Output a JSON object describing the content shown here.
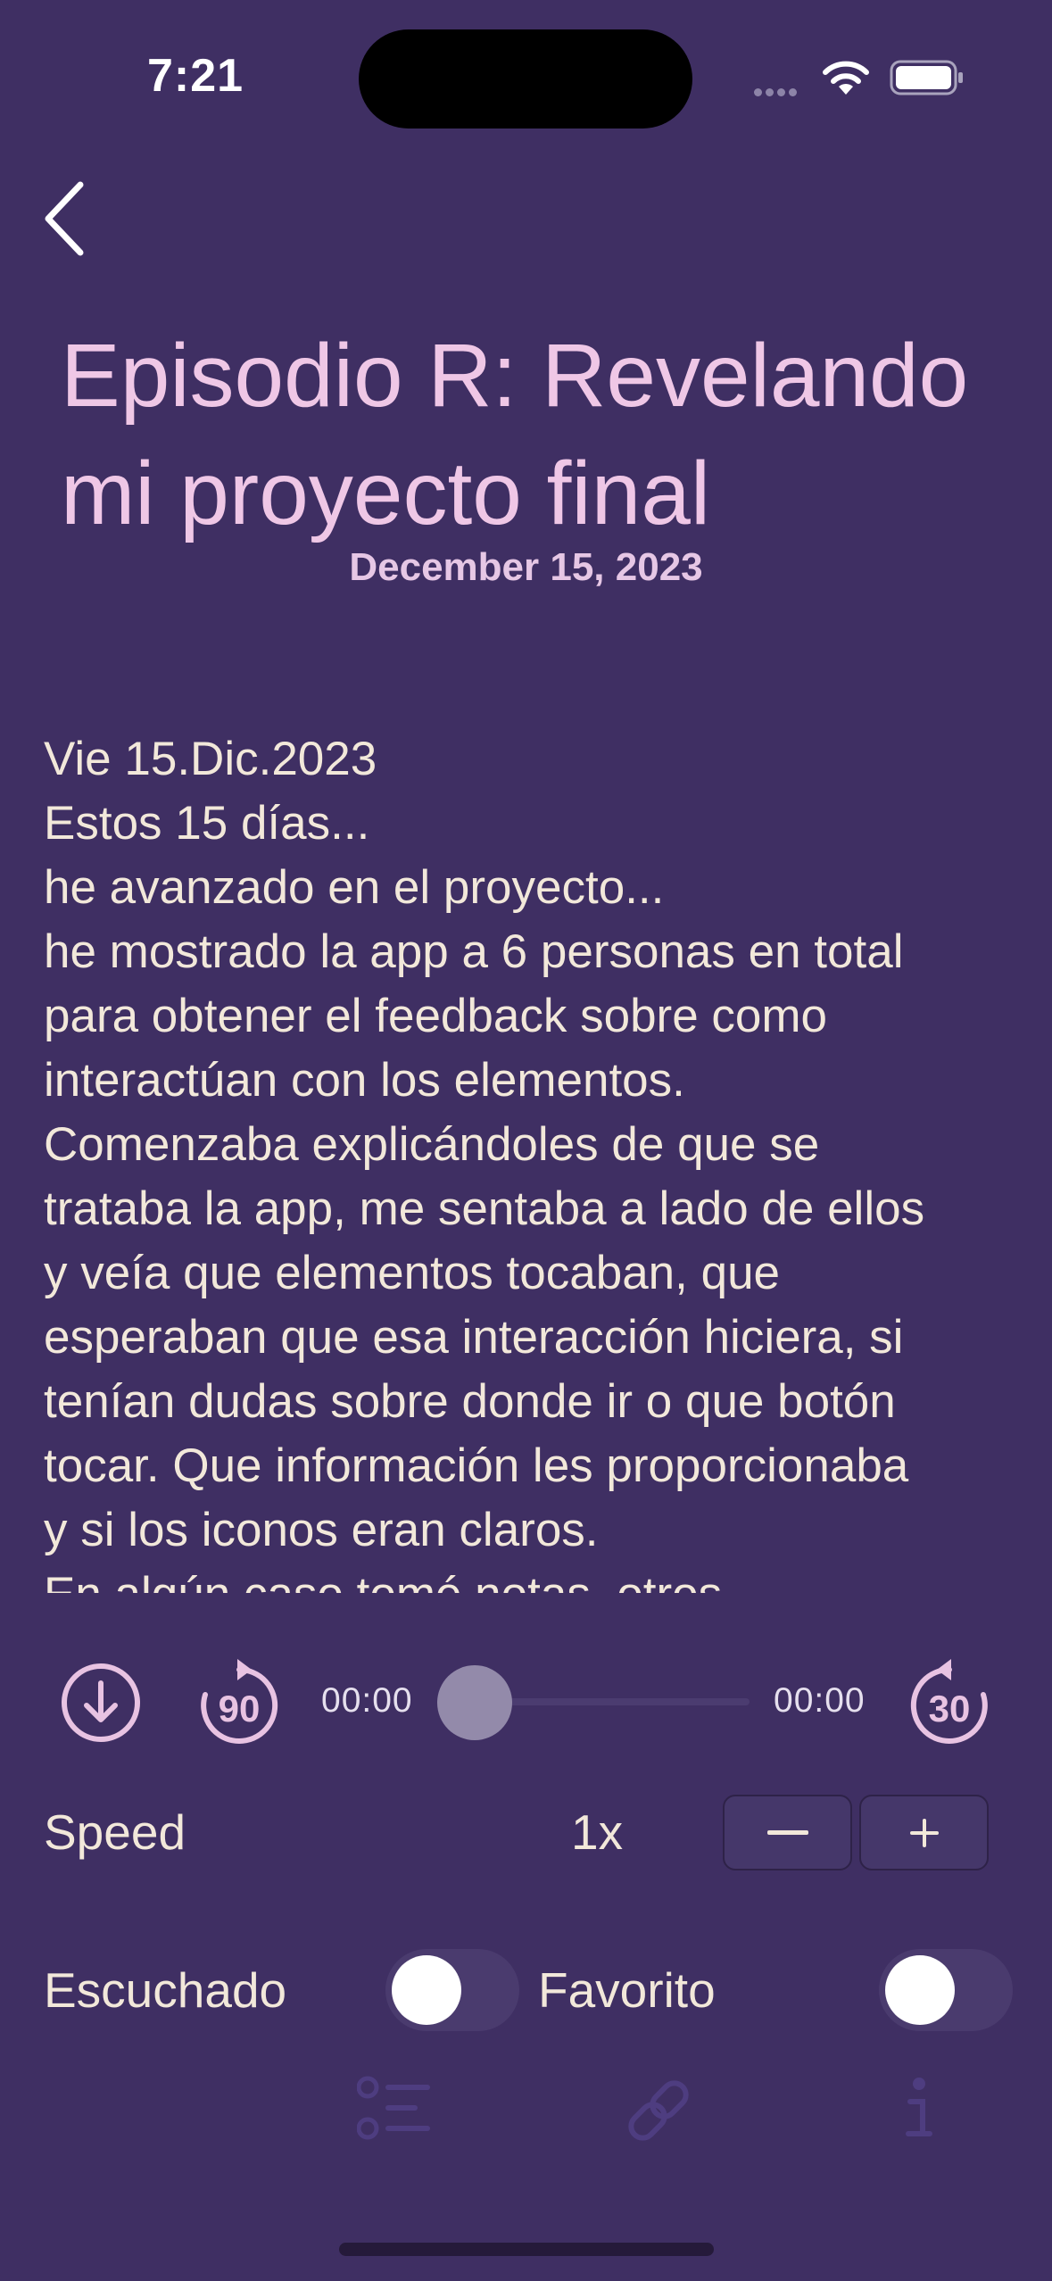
{
  "status_bar": {
    "time": "7:21"
  },
  "episode": {
    "title": "Episodio R: Revelando mi proyecto final",
    "date": "December 15, 2023",
    "description_lines": [
      "Vie 15.Dic.2023",
      "Estos 15 días...",
      "he avanzado en el proyecto...",
      "he mostrado la app a 6 personas en total",
      "para obtener el feedback sobre como",
      "interactúan con los elementos.",
      "Comenzaba explicándoles de que se",
      "trataba la app, me sentaba a lado de ellos",
      "y veía que elementos tocaban, que",
      "esperaban que esa interacción hiciera, si",
      "tenían dudas sobre donde ir o que botón",
      "tocar. Que información les proporcionaba",
      "y si los iconos eran claros.",
      "En algún caso tomé notas, otros"
    ]
  },
  "player": {
    "current_time": "00:00",
    "total_time": "00:00",
    "rewind_label": "90",
    "forward_label": "30",
    "progress": 0
  },
  "speed": {
    "label": "Speed",
    "value": "1x"
  },
  "toggles": {
    "listened_label": "Escuchado",
    "listened_on": false,
    "favorite_label": "Favorito",
    "favorite_on": false
  },
  "icons": {
    "back": "chevron-left-icon",
    "download": "arrow-down-circle-icon",
    "rewind": "gobackward-90-icon",
    "forward": "goforward-30-icon",
    "minus": "minus-icon",
    "plus": "plus-icon",
    "tab_list": "list-bullet-icon",
    "tab_link": "link-icon",
    "tab_info": "info-icon"
  },
  "colors": {
    "background": "#3f2f63",
    "title": "#efc7e6",
    "accent": "#e8c3e2",
    "text": "#f2e8da"
  }
}
